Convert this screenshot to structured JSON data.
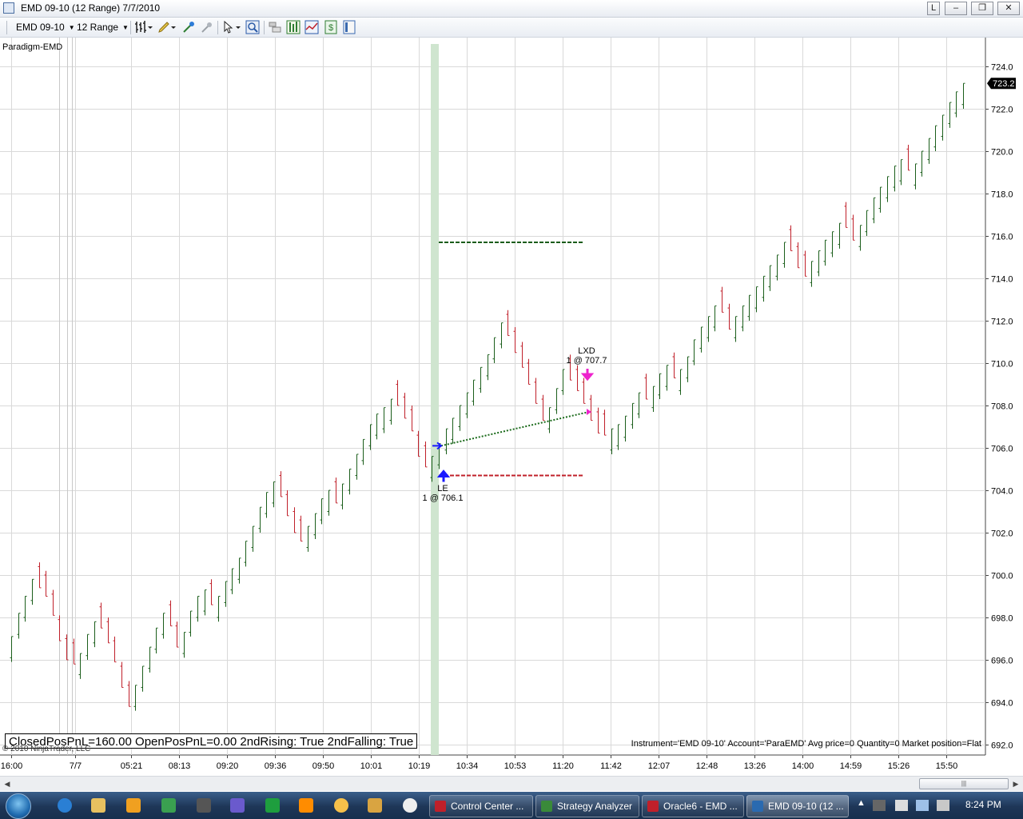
{
  "window": {
    "title": "EMD 09-10 (12 Range)  7/7/2010",
    "buttons": [
      "L",
      "–",
      "❐",
      "✕"
    ]
  },
  "toolbar": {
    "instrument": "EMD 09-10",
    "interval": "12 Range"
  },
  "chart": {
    "indicator_name": "Paradigm-EMD",
    "current_price_label": "723.2",
    "pnl_text": "ClosedPosPnL=160.00 OpenPosPnL=0.00 2ndRising: True 2ndFalling: True",
    "copyright": "© 2010 NinjaTrader, LLC",
    "instrument_info": "Instrument='EMD 09-10' Account='ParaEMD' Avg price=0 Quantity=0 Market position=Flat",
    "entry": {
      "label": "LE",
      "detail": "1 @ 706.1"
    },
    "exit": {
      "label": "LXD",
      "detail": "1 @ 707.7"
    },
    "colors": {
      "up_bar": "#1b5e1b",
      "down_bar": "#c0202a",
      "entry_marker": "#1a1aff",
      "exit_marker": "#ee22cc",
      "highlight": "#cfe5cf",
      "grid": "#d9d9d9",
      "target_line": "#1a5c1a",
      "stop_line": "#c0202a"
    }
  },
  "chart_data": {
    "type": "ohlc-range-bars",
    "instrument": "EMD 09-10",
    "bar_type": "12 Range",
    "date": "7/7/2010",
    "y_axis": {
      "min": 692.0,
      "max": 724.0,
      "ticks": [
        "724.0",
        "722.0",
        "720.0",
        "718.0",
        "716.0",
        "714.0",
        "712.0",
        "710.0",
        "708.0",
        "706.0",
        "704.0",
        "702.0",
        "700.0",
        "698.0",
        "696.0",
        "694.0",
        "692.0"
      ]
    },
    "x_axis": {
      "ticks": [
        "16:00",
        "7/7",
        "05:21",
        "08:13",
        "09:20",
        "09:36",
        "09:50",
        "10:01",
        "10:19",
        "10:34",
        "10:53",
        "11:20",
        "11:42",
        "12:07",
        "12:48",
        "13:26",
        "14:00",
        "14:59",
        "15:26",
        "15:50"
      ]
    },
    "closes": [
      697.1,
      698.2,
      699.0,
      699.8,
      699.4,
      699.0,
      698.1,
      696.9,
      696.0,
      695.8,
      696.3,
      697.2,
      697.8,
      697.5,
      696.8,
      695.9,
      694.7,
      693.8,
      694.8,
      695.7,
      696.6,
      697.5,
      698.2,
      697.6,
      696.6,
      697.3,
      698.3,
      699.0,
      699.3,
      698.6,
      699.0,
      699.7,
      700.3,
      700.8,
      701.6,
      702.3,
      703.2,
      703.9,
      704.4,
      703.7,
      702.8,
      702.0,
      701.6,
      702.3,
      702.9,
      703.6,
      704.0,
      703.4,
      704.3,
      705.0,
      705.7,
      706.4,
      707.1,
      707.6,
      707.9,
      708.3,
      708.0,
      707.4,
      706.8,
      705.6,
      705.1,
      705.6,
      706.2,
      706.9,
      707.4,
      708.0,
      708.6,
      709.2,
      709.8,
      710.4,
      711.2,
      711.9,
      711.3,
      710.5,
      709.8,
      709.0,
      708.1,
      707.3,
      707.9,
      708.8,
      709.7,
      709.2,
      708.7,
      708.1,
      707.3,
      706.7,
      706.6,
      706.9,
      707.1,
      707.5,
      708.1,
      708.6,
      708.3,
      708.9,
      709.5,
      709.9,
      709.3,
      709.7,
      710.3,
      711.1,
      711.7,
      712.2,
      712.7,
      712.4,
      711.6,
      712.2,
      712.7,
      713.2,
      713.6,
      714.1,
      714.6,
      715.1,
      715.7,
      715.3,
      714.5,
      714.1,
      714.8,
      715.3,
      715.8,
      716.2,
      716.6,
      716.4,
      715.8,
      716.5,
      717.2,
      717.8,
      718.3,
      718.8,
      719.3,
      719.6,
      719.1,
      719.4,
      720.0,
      720.6,
      721.2,
      721.7,
      722.3,
      722.8,
      723.2
    ],
    "entry_trade": {
      "side": "LE",
      "quantity": 1,
      "price": 706.1,
      "time": "10:19"
    },
    "exit_trade": {
      "side": "LXD",
      "quantity": 1,
      "price": 707.7,
      "time": "11:20"
    },
    "profit_target": 715.7,
    "stop_loss": 704.7
  },
  "scrollbar": {
    "thumb_grip": "|||"
  },
  "taskbar": {
    "tasks": [
      "Control Center ...",
      "Strategy Analyzer",
      "Oracle6 - EMD ...",
      "EMD 09-10 (12 ..."
    ],
    "clock": "8:24 PM"
  }
}
